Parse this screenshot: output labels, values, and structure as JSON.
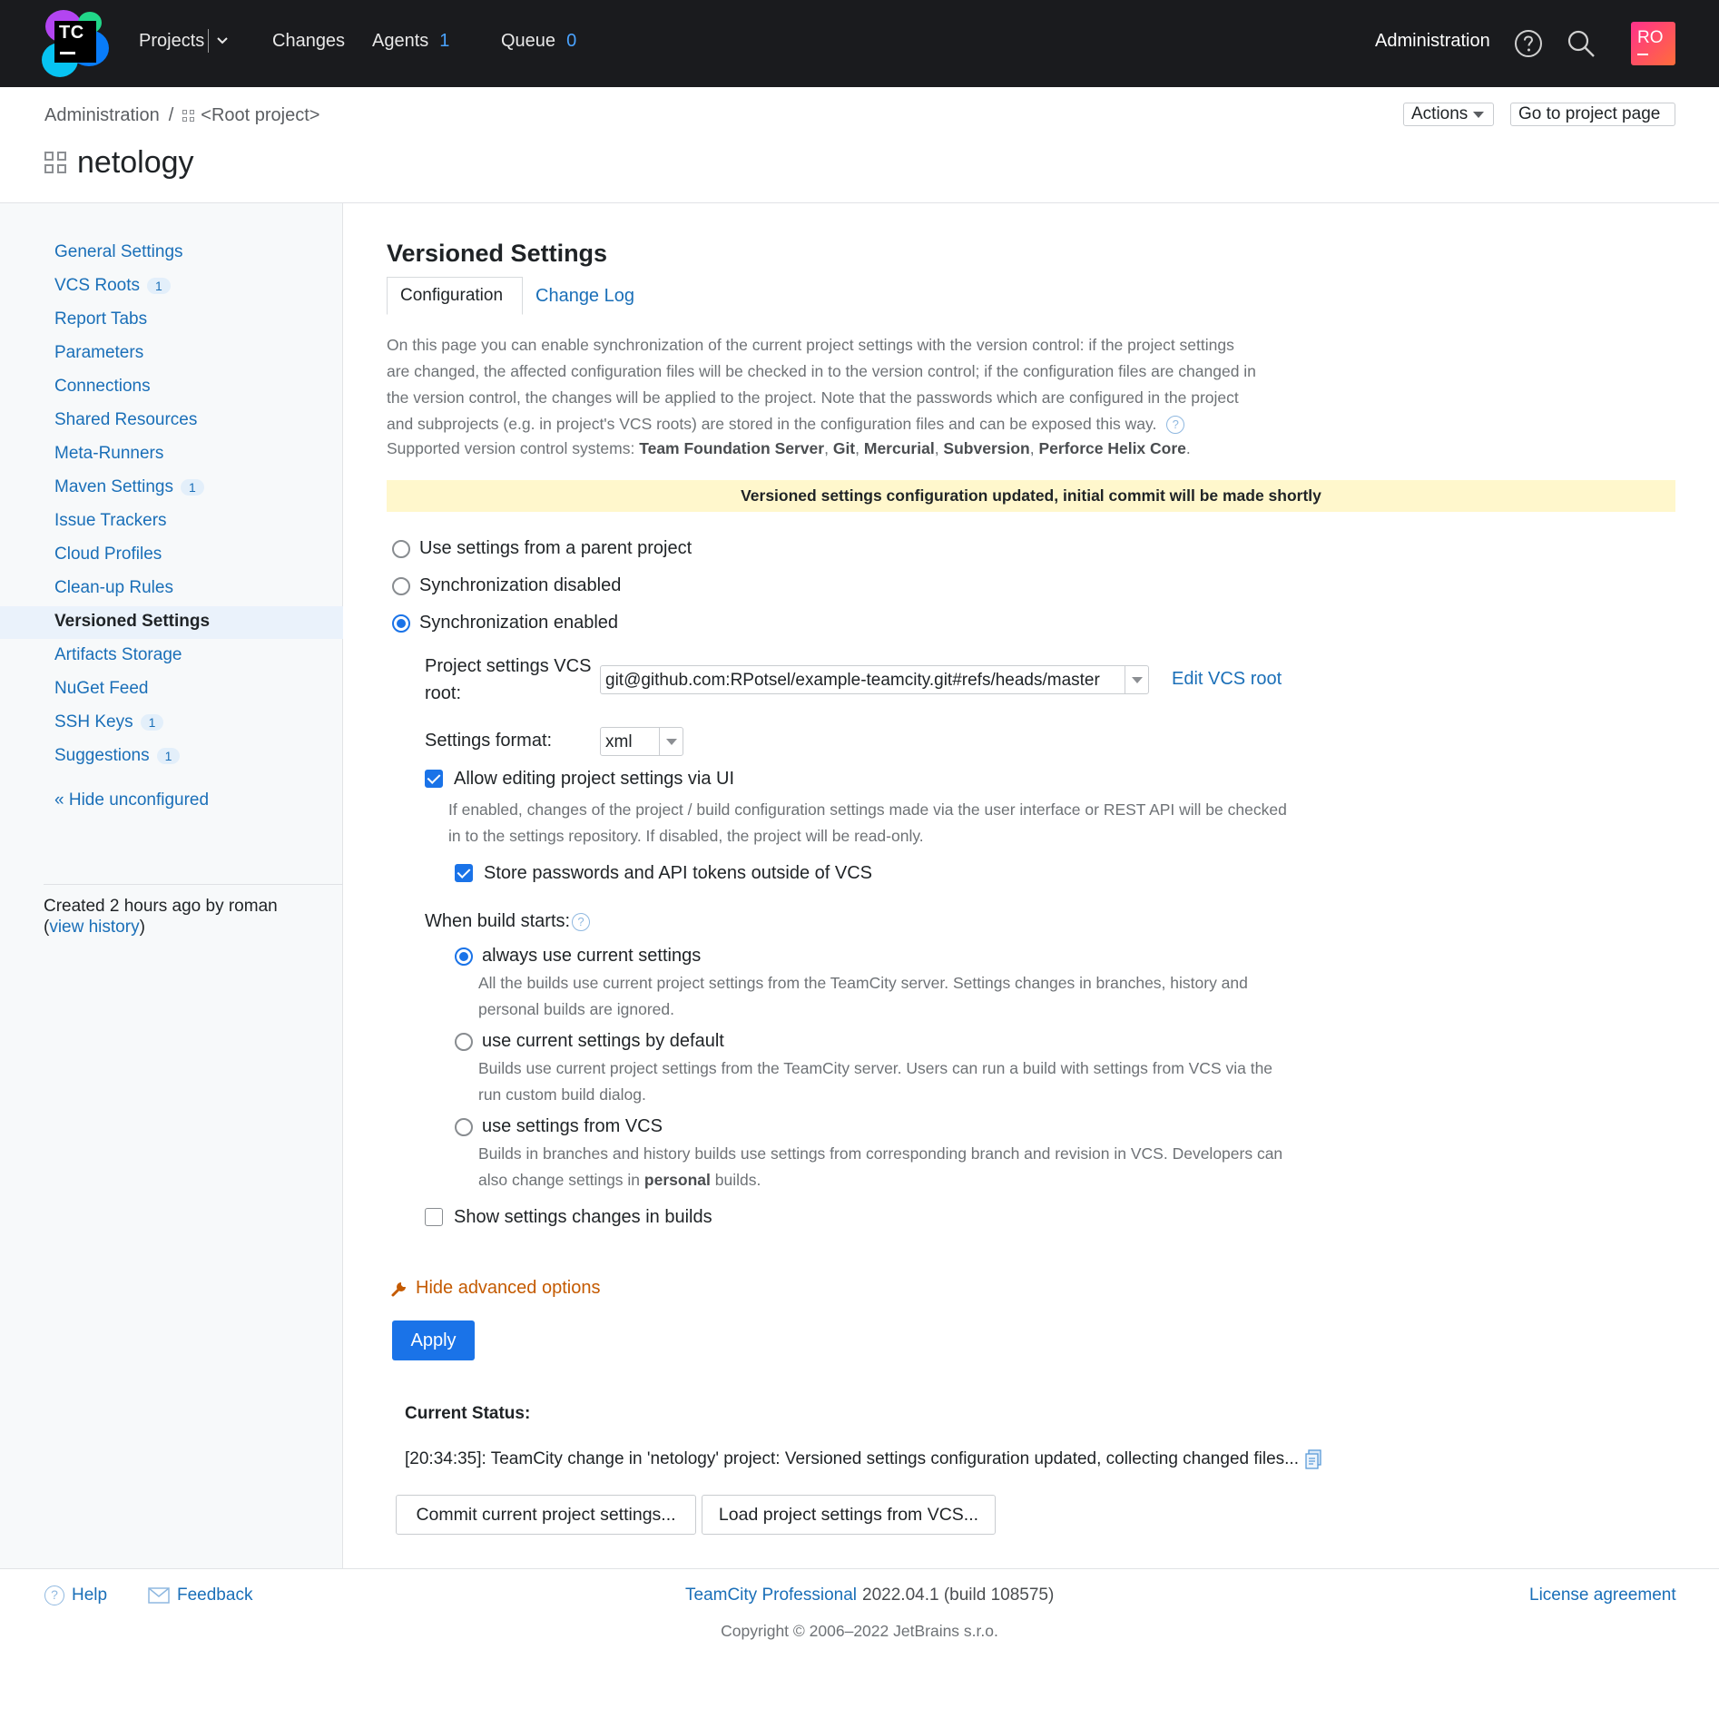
{
  "topbar": {
    "logo_text": "TC",
    "nav": {
      "projects": "Projects",
      "changes": "Changes",
      "agents": "Agents",
      "agents_count": "1",
      "queue": "Queue",
      "queue_count": "0"
    },
    "administration": "Administration",
    "avatar_initials": "RO",
    "icons": [
      "help-icon",
      "search-icon"
    ]
  },
  "header": {
    "breadcrumb": [
      "Administration",
      "<Root project>"
    ],
    "title": "netology",
    "actions_label": "Actions",
    "goto_label": "Go to project page"
  },
  "sidebar": {
    "items": [
      {
        "label": "General Settings",
        "badge": ""
      },
      {
        "label": "VCS Roots",
        "badge": "1"
      },
      {
        "label": "Report Tabs",
        "badge": ""
      },
      {
        "label": "Parameters",
        "badge": ""
      },
      {
        "label": "Connections",
        "badge": ""
      },
      {
        "label": "Shared Resources",
        "badge": ""
      },
      {
        "label": "Meta-Runners",
        "badge": ""
      },
      {
        "label": "Maven Settings",
        "badge": "1"
      },
      {
        "label": "Issue Trackers",
        "badge": ""
      },
      {
        "label": "Cloud Profiles",
        "badge": ""
      },
      {
        "label": "Clean-up Rules",
        "badge": ""
      },
      {
        "label": "Versioned Settings",
        "badge": "",
        "active": true
      },
      {
        "label": "Artifacts Storage",
        "badge": ""
      },
      {
        "label": "NuGet Feed",
        "badge": ""
      },
      {
        "label": "SSH Keys",
        "badge": "1"
      },
      {
        "label": "Suggestions",
        "badge": "1"
      }
    ],
    "hide_unconfigured": "« Hide unconfigured",
    "created_prefix": "Created 2 hours ago by roman",
    "view_history": "view history"
  },
  "main": {
    "title": "Versioned Settings",
    "tabs": [
      "Configuration",
      "Change Log"
    ],
    "description": "On this page you can enable synchronization of the current project settings with the version control: if the project settings are changed, the affected configuration files will be checked in to the version control; if the configuration files are changed in the version control, the changes will be applied to the project. Note that the passwords which are configured in the project and subprojects (e.g. in project's VCS roots) are stored in the configuration files and can be exposed this way.",
    "supported_prefix": "Supported version control systems:",
    "supported_systems": [
      "Team Foundation Server",
      "Git",
      "Mercurial",
      "Subversion",
      "Perforce Helix Core"
    ],
    "notice": "Versioned settings configuration updated, initial commit will be made shortly",
    "sync_options": [
      {
        "label": "Use settings from a parent project",
        "selected": false
      },
      {
        "label": "Synchronization disabled",
        "selected": false
      },
      {
        "label": "Synchronization enabled",
        "selected": true
      }
    ],
    "vcs_root_label_line1": "Project settings VCS",
    "vcs_root_label_line2": "root:",
    "vcs_root_value": "git@github.com:RPotsel/example-teamcity.git#refs/heads/master",
    "edit_vcs_root": "Edit VCS root",
    "settings_format_label": "Settings format:",
    "settings_format_value": "xml",
    "allow_editing_label": "Allow editing project settings via UI",
    "allow_editing_checked": true,
    "allow_editing_desc": "If enabled, changes of the project / build configuration settings made via the user interface or REST API will be checked in to the settings repository. If disabled, the project will be read-only.",
    "store_passwords_label": "Store passwords and API tokens outside of VCS",
    "store_passwords_checked": true,
    "when_build_starts": "When build starts:",
    "build_options": [
      {
        "label": "always use current settings",
        "selected": true,
        "desc": "All the builds use current project settings from the TeamCity server. Settings changes in branches, history and personal builds are ignored."
      },
      {
        "label": "use current settings by default",
        "selected": false,
        "desc": "Builds use current project settings from the TeamCity server. Users can run a build with settings from VCS via the run custom build dialog."
      },
      {
        "label": "use settings from VCS",
        "selected": false,
        "desc_pre": "Builds in branches and history builds use settings from corresponding branch and revision in VCS. Developers can also change settings in",
        "desc_bold": "personal",
        "desc_post": "builds."
      }
    ],
    "show_changes_label": "Show settings changes in builds",
    "show_changes_checked": false,
    "hide_advanced": "Hide advanced options",
    "apply": "Apply",
    "current_status_title": "Current Status:",
    "current_status_text": "[20:34:35]: TeamCity change in 'netology' project: Versioned settings configuration updated, collecting changed files...",
    "commit_button": "Commit current project settings...",
    "load_button": "Load project settings from VCS..."
  },
  "footer": {
    "help": "Help",
    "feedback": "Feedback",
    "product": "TeamCity Professional",
    "version": "2022.04.1 (build 108575)",
    "license": "License agreement",
    "copyright": "Copyright © 2006–2022 JetBrains s.r.o."
  },
  "colors": {
    "topbar_bg": "#1a1b1e",
    "link": "#1a6fb8",
    "accent": "#1a73e8",
    "notice_bg": "#fff7cc",
    "advanced_link": "#c45a00"
  }
}
